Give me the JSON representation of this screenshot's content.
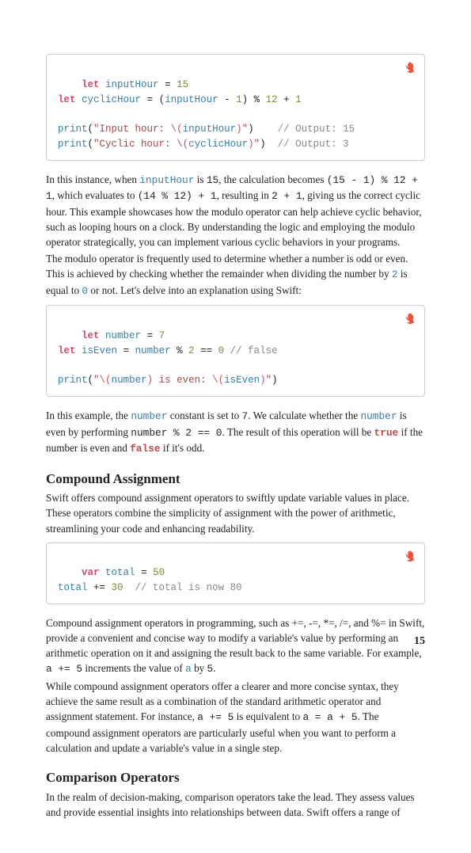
{
  "code1": {
    "l1a": "let",
    "l1b": "inputHour",
    "l1c": "= ",
    "l1d": "15",
    "l2a": "let",
    "l2b": "cyclicHour",
    "l2c": "= (",
    "l2d": "inputHour",
    "l2e": " - ",
    "l2f": "1",
    "l2g": ") % ",
    "l2h": "12",
    "l2i": " + ",
    "l2j": "1",
    "l3a": "print",
    "l3b": "(",
    "l3c": "\"Input hour: ",
    "l3d": "\\(",
    "l3e": "inputHour",
    "l3f": ")",
    "l3g": "\"",
    "l3h": ")    ",
    "l3i": "// Output: 15",
    "l4a": "print",
    "l4b": "(",
    "l4c": "\"Cyclic hour: ",
    "l4d": "\\(",
    "l4e": "cyclicHour",
    "l4f": ")",
    "l4g": "\"",
    "l4h": ")  ",
    "l4i": "// Output: 3"
  },
  "p1": {
    "t1": "In this instance, when ",
    "c1": "inputHour",
    "t2": " is ",
    "c2": "15",
    "t3": ", the calculation becomes ",
    "c3": "(15 - 1) % 12 + 1",
    "t4": ", which evaluates to ",
    "c4": "(14 % 12) + 1",
    "t5": ", resulting in ",
    "c5": "2 + 1",
    "t6": ", giving us the correct cyclic hour. This example showcases how the modulo operator can help achieve cyclic behavior, such as looping hours on a clock. By understanding the logic and employing the modulo operator strategically, you can implement various cyclic behaviors in your programs."
  },
  "p2": {
    "t1": "The modulo operator is frequently used to determine whether a number is odd or even. This is achieved by checking whether the remainder when dividing the number by ",
    "c1": "2",
    "t2": " is equal to ",
    "c2": "0",
    "t3": " or not. Let's delve into an explanation using Swift:"
  },
  "code2": {
    "l1a": "let",
    "l1b": "number",
    "l1c": "= ",
    "l1d": "7",
    "l2a": "let",
    "l2b": "isEven",
    "l2c": "= ",
    "l2d": "number",
    "l2e": " % ",
    "l2f": "2",
    "l2g": " == ",
    "l2h": "0",
    "l2i": " // false",
    "l3a": "print",
    "l3b": "(",
    "l3c": "\"",
    "l3d": "\\(",
    "l3e": "number",
    "l3f": ")",
    "l3g": " is even: ",
    "l3h": "\\(",
    "l3i": "isEven",
    "l3j": ")",
    "l3k": "\"",
    "l3l": ")"
  },
  "p3": {
    "t1": "In this example, the ",
    "c1": "number",
    "t2": " constant is set to ",
    "c2": "7",
    "t3": ". We calculate whether the ",
    "c3": "number",
    "t4": " is even by performing ",
    "c4": "number % 2 == 0",
    "t5": ". The result of this operation will be ",
    "c5": "true",
    "t6": " if the number is even and ",
    "c6": "false",
    "t7": " if it's odd."
  },
  "h1": "Compound Assignment",
  "p4": "Swift offers compound assignment operators to swiftly update variable values in place. These operators combine the simplicity of assignment with the power of arithmetic, streamlining your code and enhancing readability.",
  "code3": {
    "l1a": "var",
    "l1b": "total",
    "l1c": "= ",
    "l1d": "50",
    "l2a": "total",
    "l2b": " += ",
    "l2c": "30",
    "l2d": "  // total is now 80"
  },
  "p5": {
    "t1": "Compound assignment operators in programming, such as +=, -=, *=, /=, and %= in Swift, provide a convenient and concise way to modify a variable's value by performing an arithmetic operation on it and assigning the result back to the same variable. For example, ",
    "c1": "a += 5",
    "t2": " increments the value of ",
    "c2": "a",
    "t3": " by ",
    "c3": "5",
    "t4": "."
  },
  "p6": {
    "t1": "While compound assignment operators offer a clearer and more concise syntax, they achieve the same result as a combination of the standard arithmetic operator and assignment statement. For instance, ",
    "c1": "a += 5",
    "t2": " is equivalent to ",
    "c2": "a = a + 5",
    "t3": ". The compound assignment operators are particularly useful when you want to perform a calculation and update a variable's value in a single step."
  },
  "h2": "Comparison Operators",
  "p7": "In the realm of decision-making, comparison operators take the lead. They assess values and provide essential insights into relationships between data. Swift offers a range of",
  "pageNum": "15"
}
